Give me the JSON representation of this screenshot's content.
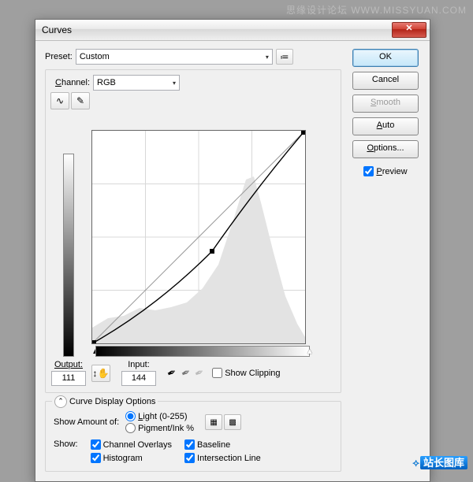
{
  "window": {
    "title": "Curves"
  },
  "buttons": {
    "ok": "OK",
    "cancel": "Cancel",
    "smooth": "Smooth",
    "auto": "Auto",
    "options": "Options...",
    "preview": "Preview"
  },
  "preset": {
    "label": "Preset:",
    "value": "Custom"
  },
  "channel": {
    "label": "Channel:",
    "value": "RGB"
  },
  "output": {
    "label": "Output:",
    "value": "111"
  },
  "input": {
    "label": "Input:",
    "value": "144"
  },
  "show_clipping": "Show Clipping",
  "display_options": {
    "legend": "Curve Display Options",
    "amount_label": "Show Amount of:",
    "radio_light": "Light  (0-255)",
    "radio_pigment": "Pigment/Ink %",
    "show_label": "Show:",
    "overlays": "Channel Overlays",
    "histogram": "Histogram",
    "baseline": "Baseline",
    "intersection": "Intersection Line"
  },
  "watermarks": {
    "top": "思缘设计论坛  WWW.MISSYUAN.COM",
    "bottom_zh": "站长图库"
  },
  "chart_data": {
    "type": "line",
    "title": "RGB tone curve with histogram",
    "xlabel": "Input",
    "ylabel": "Output",
    "xlim": [
      0,
      255
    ],
    "ylim": [
      0,
      255
    ],
    "series": [
      {
        "name": "baseline",
        "x": [
          0,
          255
        ],
        "y": [
          0,
          255
        ]
      },
      {
        "name": "curve",
        "x": [
          0,
          64,
          128,
          144,
          192,
          255
        ],
        "y": [
          0,
          35,
          92,
          111,
          175,
          253
        ]
      }
    ],
    "control_point": {
      "x": 144,
      "y": 111
    },
    "histogram_peak_input": 192,
    "grid": true
  }
}
